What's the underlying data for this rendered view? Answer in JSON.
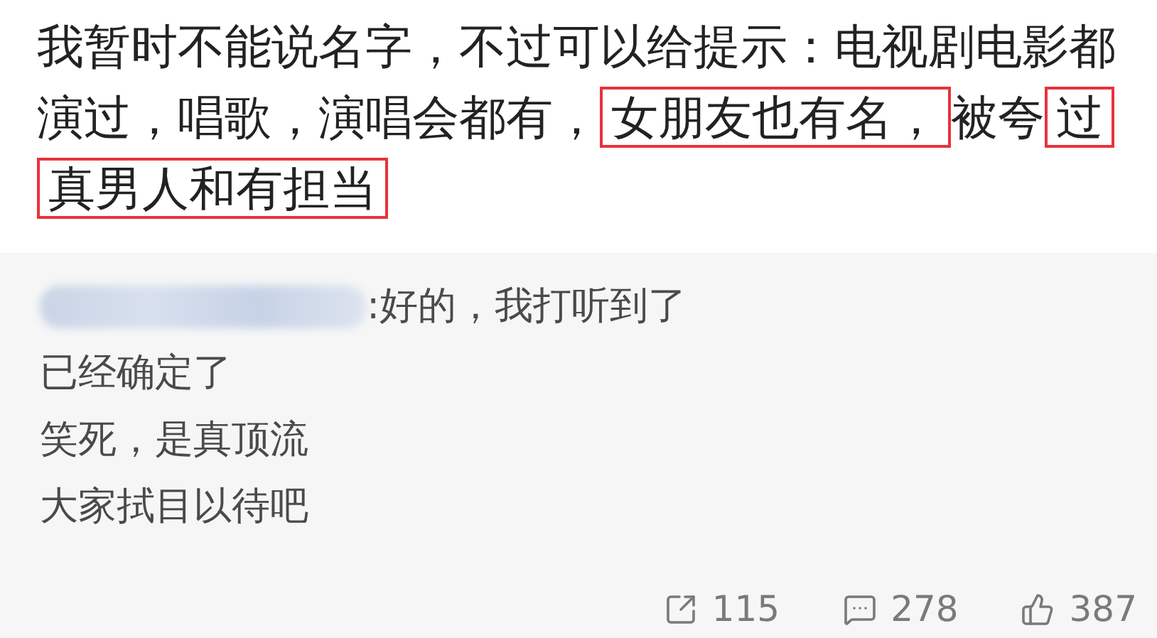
{
  "post": {
    "segments": [
      {
        "text": "我暂时不能说名字，不过可以给提示：电视剧电影都演过，唱歌，演唱会都有，",
        "highlighted": false
      },
      {
        "text": "女朋友也有名，",
        "highlighted": true
      },
      {
        "text": "被夸",
        "highlighted": false
      },
      {
        "text": "过真男人和有担当",
        "highlighted": true
      }
    ]
  },
  "comment": {
    "lines": [
      ":好的，我打听到了",
      "已经确定了",
      "笑死，是真顶流",
      "大家拭目以待吧"
    ]
  },
  "stats": [
    {
      "kind": "share",
      "count": "115"
    },
    {
      "kind": "comment",
      "count": "278"
    },
    {
      "kind": "like",
      "count": "387"
    }
  ]
}
